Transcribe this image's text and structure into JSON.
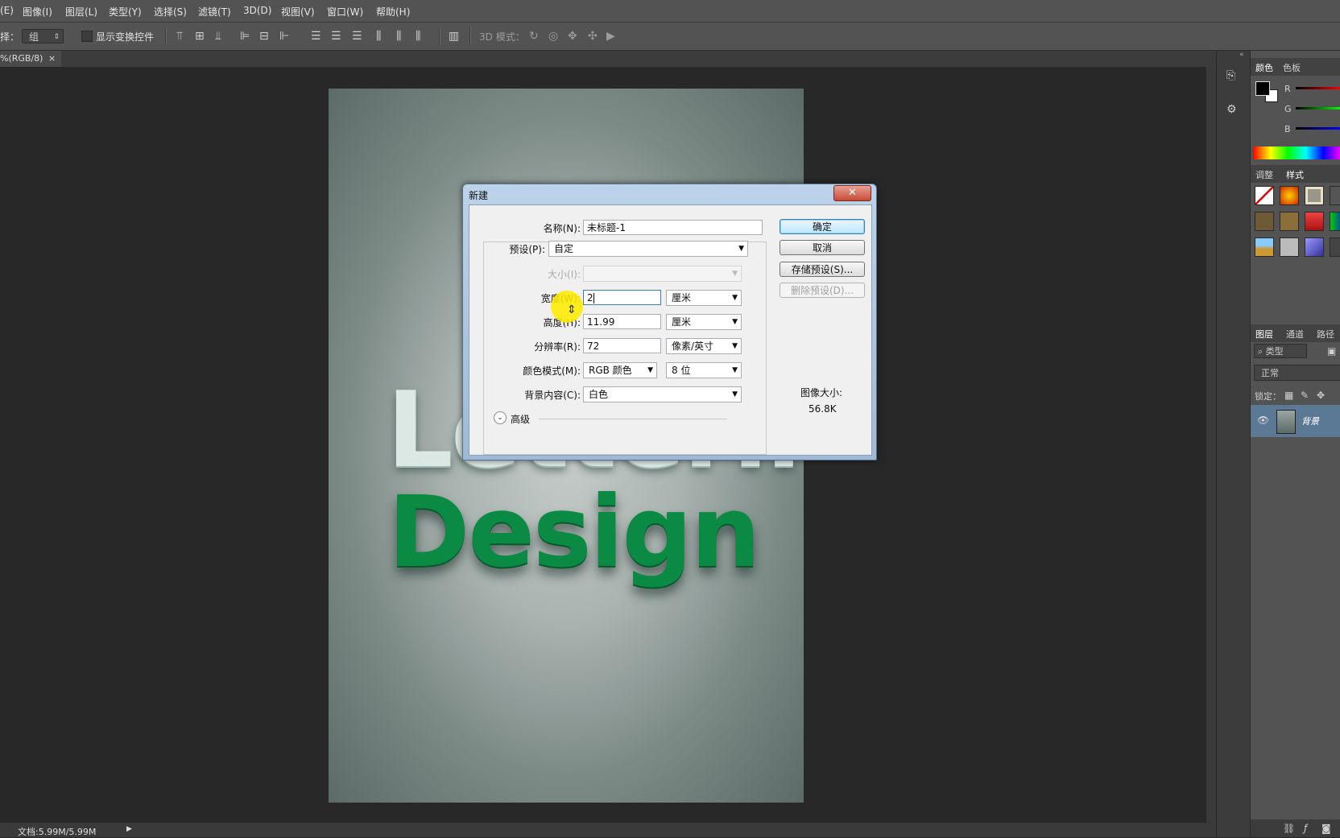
{
  "menu": [
    "(E)",
    "图像(I)",
    "图层(L)",
    "类型(Y)",
    "选择(S)",
    "滤镜(T)",
    "3D(D)",
    "视图(V)",
    "窗口(W)",
    "帮助(H)"
  ],
  "options": {
    "select_label": "择：",
    "select_value": "组",
    "show_transform": "显示变换控件",
    "mode3d": "3D 模式："
  },
  "doc_tab": {
    "label": "%(RGB/8)",
    "close": "×"
  },
  "canvas": {
    "line1": "Lettering",
    "line2": "Design"
  },
  "status": {
    "doc": "文档:5.99M/5.99M"
  },
  "panels": {
    "color_tabs": [
      "颜色",
      "色板"
    ],
    "channels": [
      "R",
      "G",
      "B"
    ],
    "style_tabs": [
      "调整",
      "样式"
    ],
    "layer_tabs": [
      "图层",
      "通道",
      "路径"
    ],
    "kind": "类型",
    "blend": "正常",
    "lock": "锁定：",
    "layer_name": "背景"
  },
  "dialog": {
    "title": "新建",
    "close": "✕",
    "name_label": "名称(N):",
    "name_value": "未标题-1",
    "preset_label": "预设(P):",
    "preset_value": "自定",
    "size_label": "大小(I):",
    "width_label": "宽度(W):",
    "width_value": "2",
    "width_unit": "厘米",
    "height_label": "高度(H):",
    "height_value": "11.99",
    "height_unit": "厘米",
    "res_label": "分辨率(R):",
    "res_value": "72",
    "res_unit": "像素/英寸",
    "mode_label": "颜色模式(M):",
    "mode_value": "RGB 颜色",
    "depth_value": "8 位",
    "bg_label": "背景内容(C):",
    "bg_value": "白色",
    "advanced": "高级",
    "ok": "确定",
    "cancel": "取消",
    "save_preset": "存储预设(S)...",
    "delete_preset": "删除预设(D)...",
    "image_size_label": "图像大小:",
    "image_size_value": "56.8K"
  }
}
